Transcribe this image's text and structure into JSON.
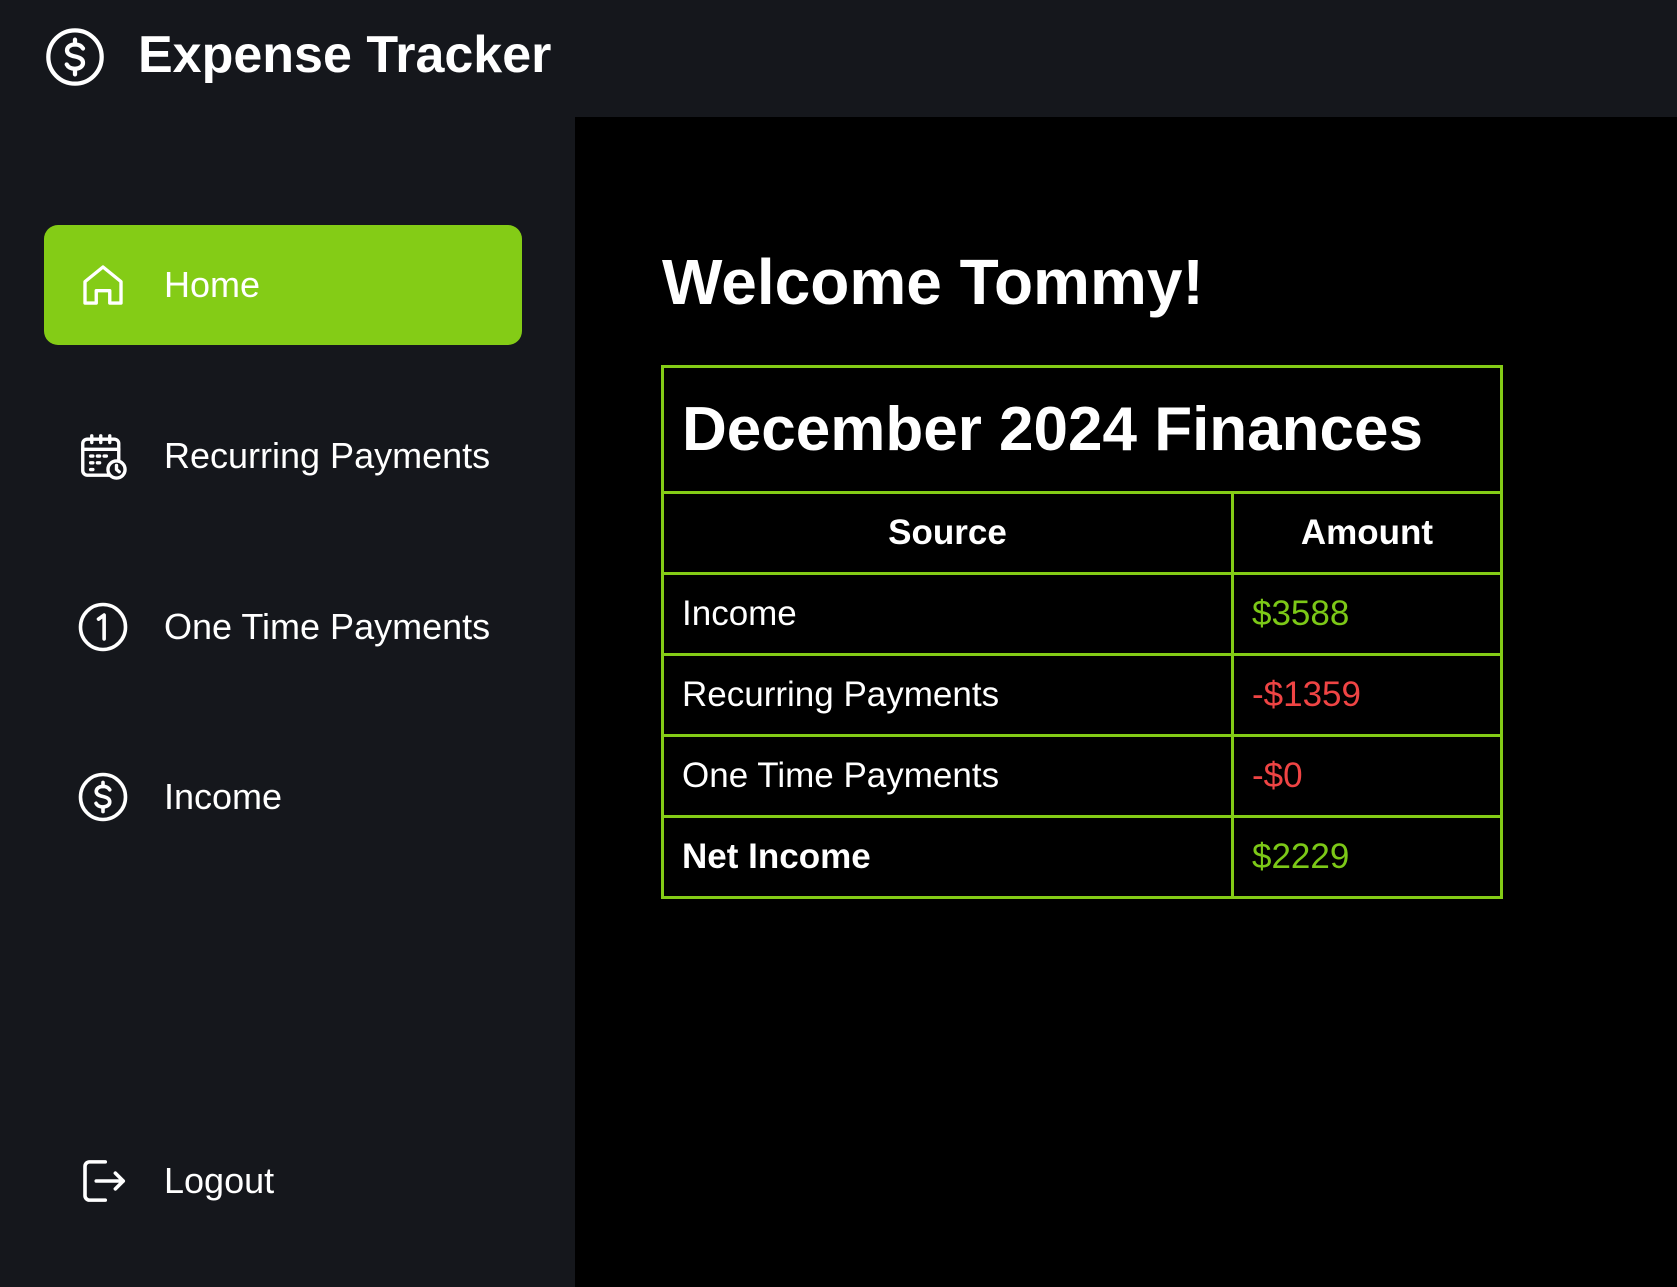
{
  "header": {
    "app_title": "Expense Tracker",
    "logo_icon": "dollar-circle-icon"
  },
  "sidebar": {
    "items": [
      {
        "label": "Home",
        "icon": "home-icon",
        "active": true
      },
      {
        "label": "Recurring Payments",
        "icon": "calendar-clock-icon",
        "active": false
      },
      {
        "label": "One Time Payments",
        "icon": "number-one-circle-icon",
        "active": false
      },
      {
        "label": "Income",
        "icon": "dollar-circle-icon",
        "active": false
      }
    ],
    "logout": {
      "label": "Logout",
      "icon": "logout-icon"
    }
  },
  "main": {
    "welcome": "Welcome Tommy!",
    "finances": {
      "title": "December 2024 Finances",
      "columns": [
        "Source",
        "Amount"
      ],
      "rows": [
        {
          "source": "Income",
          "amount": "$3588"
        },
        {
          "source": "Recurring Payments",
          "amount": "-$1359"
        },
        {
          "source": "One Time Payments",
          "amount": "-$0"
        },
        {
          "source": "Net Income",
          "amount": "$2229"
        }
      ]
    }
  },
  "colors": {
    "accent": "#84cc16",
    "positive": "#7cc817",
    "negative": "#ef4444",
    "panel_bg": "#15171c",
    "main_bg": "#000000"
  }
}
